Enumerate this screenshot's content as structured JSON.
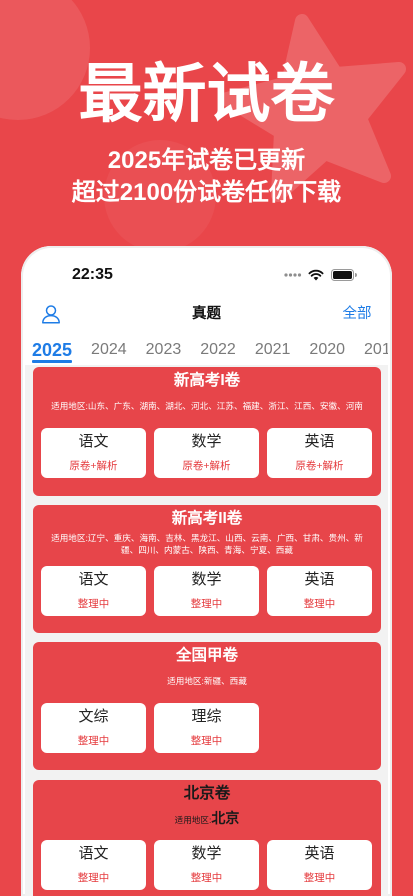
{
  "colors": {
    "background": "#E9464A",
    "card": "#E7454A",
    "accent_blue": "#1E7CE6",
    "status_red": "#E53A3D",
    "tab_inactive": "#7A7A7A"
  },
  "promo": {
    "headline": "最新试卷",
    "line1": "2025年试卷已更新",
    "line2": "超过2100份试卷任你下载"
  },
  "status_bar": {
    "time": "22:35",
    "icons": [
      "cellular-signal-icon",
      "wifi-icon",
      "battery-icon"
    ]
  },
  "nav": {
    "left_icon": "user-icon",
    "title": "真题",
    "right_label": "全部"
  },
  "tabs": [
    {
      "label": "2025",
      "selected": true
    },
    {
      "label": "2024",
      "selected": false
    },
    {
      "label": "2023",
      "selected": false
    },
    {
      "label": "2022",
      "selected": false
    },
    {
      "label": "2021",
      "selected": false
    },
    {
      "label": "2020",
      "selected": false
    },
    {
      "label": "201",
      "selected": false
    }
  ],
  "cards": [
    {
      "title": "新高考I卷",
      "region_label": "适用地区:",
      "regions": "山东、广东、湖南、湖北、河北、江苏、福建、浙江、江西、安徽、河南",
      "subjects": [
        {
          "name": "语文",
          "status": "原卷+解析"
        },
        {
          "name": "数学",
          "status": "原卷+解析"
        },
        {
          "name": "英语",
          "status": "原卷+解析"
        }
      ]
    },
    {
      "title": "新高考II卷",
      "region_label": "适用地区:",
      "regions": "辽宁、重庆、海南、吉林、黑龙江、山西、云南、广西、甘肃、贵州、新疆、四川、内蒙古、陕西、青海、宁夏、西藏",
      "subjects": [
        {
          "name": "语文",
          "status": "整理中"
        },
        {
          "name": "数学",
          "status": "整理中"
        },
        {
          "name": "英语",
          "status": "整理中"
        }
      ]
    },
    {
      "title": "全国甲卷",
      "region_label": "适用地区:",
      "regions": "新疆、西藏",
      "subjects": [
        {
          "name": "文综",
          "status": "整理中"
        },
        {
          "name": "理综",
          "status": "整理中"
        }
      ]
    },
    {
      "title": "北京卷",
      "region_label": "适用地区:",
      "regions": "北京",
      "subjects": [
        {
          "name": "语文",
          "status": "整理中"
        },
        {
          "name": "数学",
          "status": "整理中"
        },
        {
          "name": "英语",
          "status": "整理中"
        }
      ]
    }
  ]
}
